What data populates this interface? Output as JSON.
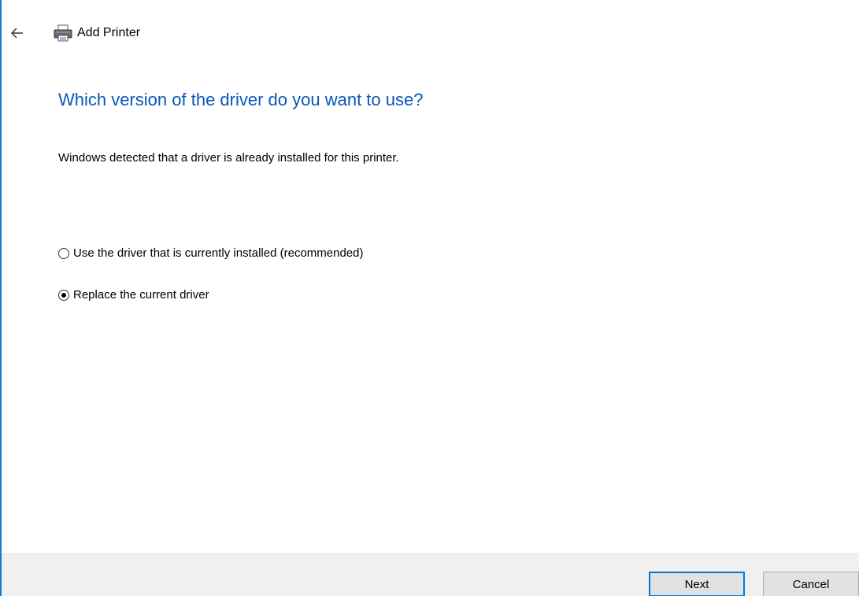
{
  "window": {
    "title": "Add Printer"
  },
  "page": {
    "heading": "Which version of the driver do you want to use?",
    "description": "Windows detected that a driver is already installed for this printer."
  },
  "options": [
    {
      "label": "Use the driver that is currently installed (recommended)",
      "selected": false
    },
    {
      "label": "Replace the current driver",
      "selected": true
    }
  ],
  "buttons": {
    "next": "Next",
    "cancel": "Cancel"
  },
  "colors": {
    "heading": "#0a58b8",
    "accent_border": "#1979ca",
    "default_button_border": "#0078d7",
    "footer_background": "#f0f0f0"
  },
  "icons": {
    "back": "back-arrow-icon",
    "printer": "printer-icon"
  }
}
